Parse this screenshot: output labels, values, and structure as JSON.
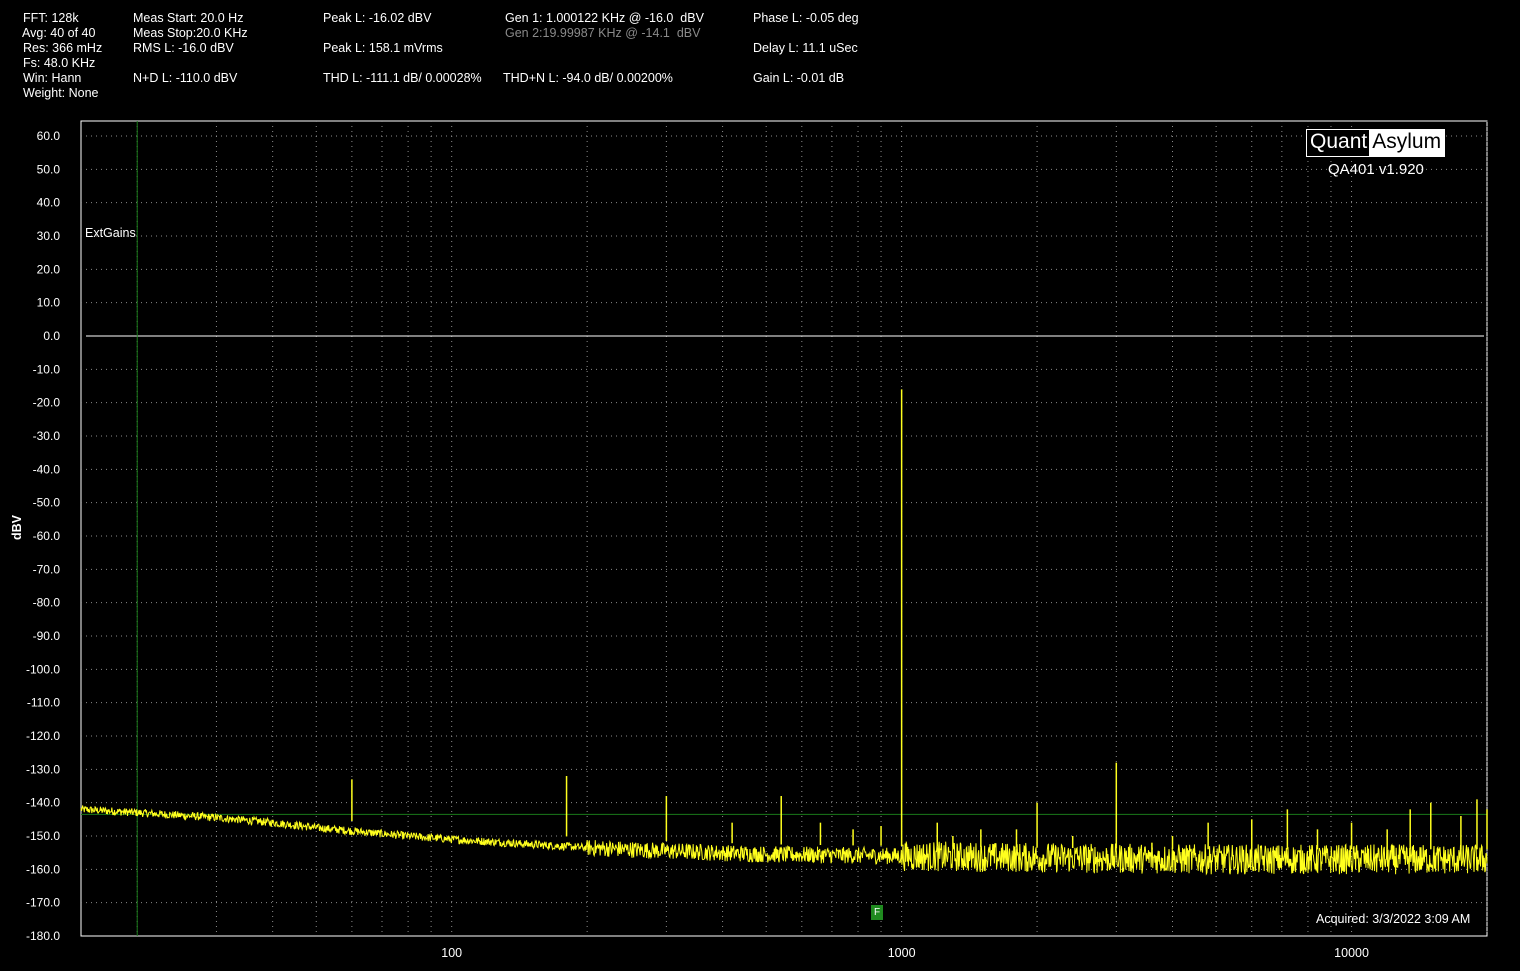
{
  "header": {
    "col1": [
      "FFT: 128k",
      "Avg: 40 of 40",
      "Res: 366 mHz",
      "Fs: 48.0 KHz",
      "Win: Hann",
      "Weight: None"
    ],
    "col2": [
      "Meas Start: 20.0 Hz",
      "Meas Stop:20.0 KHz",
      "RMS L: -16.0 dBV",
      "N+D L: -110.0 dBV"
    ],
    "peak_l_dbv": "Peak L: -16.02 dBV",
    "peak_l_mvrms": "Peak L: 158.1 mVrms",
    "thd_l": "THD L: -111.1 dB/ 0.00028%",
    "gen1": "Gen 1: 1.000122 KHz @ -16.0  dBV",
    "gen2": "Gen 2:19.99987 KHz @ -14.1  dBV",
    "thdn_l": "THD+N L: -94.0 dB/ 0.00200%",
    "phase_l": "Phase L: -0.05 deg",
    "delay_l": "Delay L: 11.1 uSec",
    "gain_l": "Gain L: -0.01 dB"
  },
  "logo": {
    "left": "Quant",
    "right": "Asylum",
    "version": "QA401 v1.920"
  },
  "overlay": {
    "ext_gains": "ExtGains",
    "acquired": "Acquired: 3/3/2022  3:09 AM",
    "marker": "F"
  },
  "colors": {
    "background": "#000000",
    "trace": "#ffff1e",
    "grid": "#8c8c8c",
    "zero_line": "#ffffff",
    "reference": "#1a7a1a"
  },
  "chart_data": {
    "type": "line",
    "title": "",
    "xlabel": "",
    "ylabel": "dBV",
    "x_scale": "log",
    "xlim": [
      15,
      20000
    ],
    "ylim": [
      -180,
      60
    ],
    "x_ticks": [
      "100",
      "1000",
      "10000"
    ],
    "x_tick_values": [
      100,
      1000,
      10000
    ],
    "y_ticks": [
      "60.0",
      "50.0",
      "40.0",
      "30.0",
      "20.0",
      "10.0",
      "0.0",
      "-10.0",
      "-20.0",
      "-30.0",
      "-40.0",
      "-50.0",
      "-60.0",
      "-70.0",
      "-80.0",
      "-90.0",
      "-100.0",
      "-110.0",
      "-120.0",
      "-130.0",
      "-140.0",
      "-150.0",
      "-160.0",
      "-170.0",
      "-180.0"
    ],
    "grid": true,
    "reference_lines": {
      "vertical_hz": 20,
      "horizontal_dbv": -143.5,
      "zero_dbv": 0
    },
    "series": [
      {
        "noise_floor": [
          [
            15,
            -142
          ],
          [
            20,
            -143
          ],
          [
            30,
            -144.5
          ],
          [
            40,
            -146
          ],
          [
            50,
            -147.5
          ],
          [
            60,
            -148.5
          ],
          [
            80,
            -150
          ],
          [
            100,
            -151
          ],
          [
            150,
            -152.5
          ],
          [
            200,
            -153.5
          ],
          [
            300,
            -154.5
          ],
          [
            500,
            -155.5
          ],
          [
            1000,
            -156
          ],
          [
            2000,
            -156.5
          ],
          [
            5000,
            -157
          ],
          [
            10000,
            -157
          ],
          [
            20000,
            -157
          ]
        ],
        "peaks": [
          [
            60,
            -133
          ],
          [
            180,
            -132
          ],
          [
            300,
            -138
          ],
          [
            420,
            -146
          ],
          [
            540,
            -138
          ],
          [
            660,
            -146
          ],
          [
            780,
            -148
          ],
          [
            900,
            -147
          ],
          [
            1000,
            -16
          ],
          [
            1200,
            -146
          ],
          [
            1300,
            -150
          ],
          [
            1500,
            -148
          ],
          [
            1800,
            -148
          ],
          [
            2000,
            -140
          ],
          [
            2400,
            -150
          ],
          [
            3000,
            -128
          ],
          [
            3600,
            -152
          ],
          [
            4000,
            -150
          ],
          [
            4800,
            -146
          ],
          [
            6000,
            -145
          ],
          [
            7200,
            -142
          ],
          [
            8400,
            -148
          ],
          [
            10000,
            -146
          ],
          [
            12000,
            -148
          ],
          [
            13500,
            -142
          ],
          [
            15000,
            -140
          ],
          [
            17500,
            -144
          ],
          [
            19000,
            -139
          ],
          [
            20000,
            -142
          ]
        ]
      }
    ]
  }
}
